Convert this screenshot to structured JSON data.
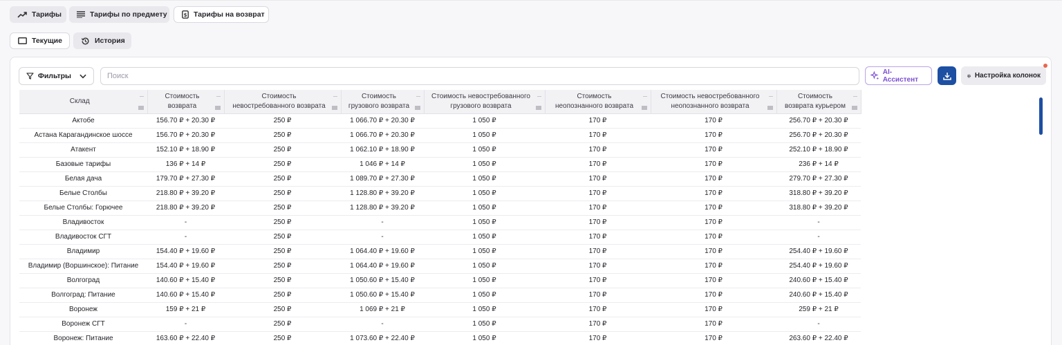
{
  "top_tabs": [
    {
      "label": "Тарифы",
      "icon": "trend-up-icon"
    },
    {
      "label": "Тарифы по предмету",
      "icon": "list-lines-icon"
    },
    {
      "label": "Тарифы на возврат",
      "icon": "document-icon"
    }
  ],
  "sub_tabs": [
    {
      "label": "Текущие",
      "icon": "rectangle-icon"
    },
    {
      "label": "История",
      "icon": "history-icon"
    }
  ],
  "toolbar": {
    "filters_label": "Фильтры",
    "search_placeholder": "Поиск",
    "ai_label": "AI-Ассистент",
    "columns_label": "Настройка колонок"
  },
  "table": {
    "columns": [
      [
        "Склад"
      ],
      [
        "Стоимость",
        "возврата"
      ],
      [
        "Стоимость",
        "невостребованного возврата"
      ],
      [
        "Стоимость",
        "грузового возврата"
      ],
      [
        "Стоимость невостребованного",
        "грузового возврата"
      ],
      [
        "Стоимость",
        "неопознанного возврата"
      ],
      [
        "Стоимость невостребованного",
        "неопознанного возврата"
      ],
      [
        "Стоимость",
        "возврата курьером"
      ]
    ],
    "rows": [
      [
        "Актобе",
        "156.70 ₽ + 20.30 ₽",
        "250 ₽",
        "1 066.70 ₽ + 20.30 ₽",
        "1 050 ₽",
        "170 ₽",
        "170 ₽",
        "256.70 ₽ + 20.30 ₽"
      ],
      [
        "Астана Карагандинское шоссе",
        "156.70 ₽ + 20.30 ₽",
        "250 ₽",
        "1 066.70 ₽ + 20.30 ₽",
        "1 050 ₽",
        "170 ₽",
        "170 ₽",
        "256.70 ₽ + 20.30 ₽"
      ],
      [
        "Атакент",
        "152.10 ₽ + 18.90 ₽",
        "250 ₽",
        "1 062.10 ₽ + 18.90 ₽",
        "1 050 ₽",
        "170 ₽",
        "170 ₽",
        "252.10 ₽ + 18.90 ₽"
      ],
      [
        "Базовые тарифы",
        "136 ₽ + 14 ₽",
        "250 ₽",
        "1 046 ₽ + 14 ₽",
        "1 050 ₽",
        "170 ₽",
        "170 ₽",
        "236 ₽ + 14 ₽"
      ],
      [
        "Белая дача",
        "179.70 ₽ + 27.30 ₽",
        "250 ₽",
        "1 089.70 ₽ + 27.30 ₽",
        "1 050 ₽",
        "170 ₽",
        "170 ₽",
        "279.70 ₽ + 27.30 ₽"
      ],
      [
        "Белые Столбы",
        "218.80 ₽ + 39.20 ₽",
        "250 ₽",
        "1 128.80 ₽ + 39.20 ₽",
        "1 050 ₽",
        "170 ₽",
        "170 ₽",
        "318.80 ₽ + 39.20 ₽"
      ],
      [
        "Белые Столбы: Горючее",
        "218.80 ₽ + 39.20 ₽",
        "250 ₽",
        "1 128.80 ₽ + 39.20 ₽",
        "1 050 ₽",
        "170 ₽",
        "170 ₽",
        "318.80 ₽ + 39.20 ₽"
      ],
      [
        "Владивосток",
        "-",
        "250 ₽",
        "-",
        "1 050 ₽",
        "170 ₽",
        "170 ₽",
        "-"
      ],
      [
        "Владивосток СГТ",
        "-",
        "250 ₽",
        "-",
        "1 050 ₽",
        "170 ₽",
        "170 ₽",
        "-"
      ],
      [
        "Владимир",
        "154.40 ₽ + 19.60 ₽",
        "250 ₽",
        "1 064.40 ₽ + 19.60 ₽",
        "1 050 ₽",
        "170 ₽",
        "170 ₽",
        "254.40 ₽ + 19.60 ₽"
      ],
      [
        "Владимир (Воршинское): Питание",
        "154.40 ₽ + 19.60 ₽",
        "250 ₽",
        "1 064.40 ₽ + 19.60 ₽",
        "1 050 ₽",
        "170 ₽",
        "170 ₽",
        "254.40 ₽ + 19.60 ₽"
      ],
      [
        "Волгоград",
        "140.60 ₽ + 15.40 ₽",
        "250 ₽",
        "1 050.60 ₽ + 15.40 ₽",
        "1 050 ₽",
        "170 ₽",
        "170 ₽",
        "240.60 ₽ + 15.40 ₽"
      ],
      [
        "Волгоград: Питание",
        "140.60 ₽ + 15.40 ₽",
        "250 ₽",
        "1 050.60 ₽ + 15.40 ₽",
        "1 050 ₽",
        "170 ₽",
        "170 ₽",
        "240.60 ₽ + 15.40 ₽"
      ],
      [
        "Воронеж",
        "159 ₽ + 21 ₽",
        "250 ₽",
        "1 069 ₽ + 21 ₽",
        "1 050 ₽",
        "170 ₽",
        "170 ₽",
        "259 ₽ + 21 ₽"
      ],
      [
        "Воронеж СГТ",
        "-",
        "250 ₽",
        "-",
        "1 050 ₽",
        "170 ₽",
        "170 ₽",
        "-"
      ],
      [
        "Воронеж: Питание",
        "163.60 ₽ + 22.40 ₽",
        "250 ₽",
        "1 073.60 ₽ + 22.40 ₽",
        "1 050 ₽",
        "170 ₽",
        "170 ₽",
        "263.60 ₽ + 22.40 ₽"
      ]
    ]
  },
  "colors": {
    "accent": "#1d4fa3",
    "ai": "#7b4fd3",
    "notification": "#e8674f"
  }
}
